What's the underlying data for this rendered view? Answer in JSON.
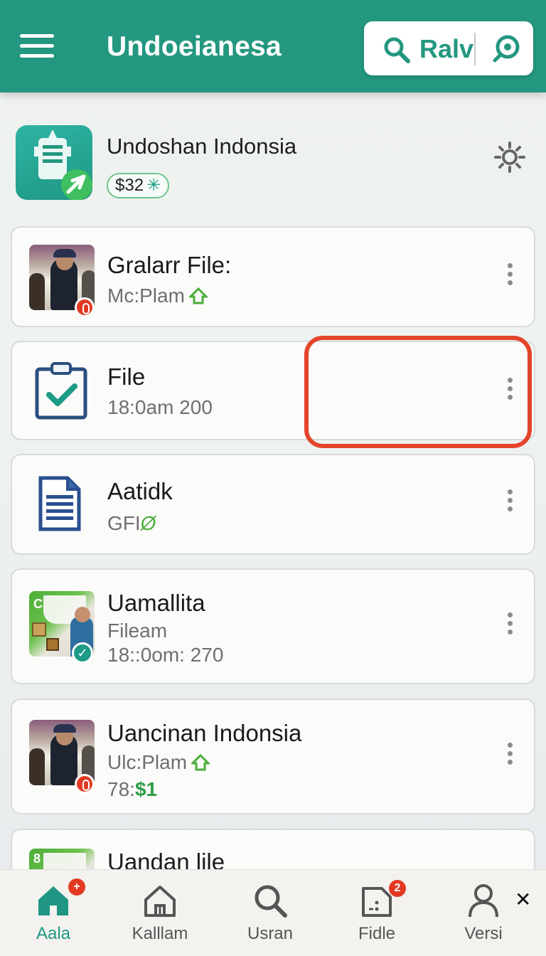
{
  "app_bar": {
    "title": "Undoeianesa",
    "search_text": "Ralv"
  },
  "profile": {
    "name": "Undoshan Indonsia",
    "balance": "$32"
  },
  "items": [
    {
      "title": "Gralarr File:",
      "subtitle": "Mc:Plam"
    },
    {
      "title": "File",
      "subtitle": "18:0am 200"
    },
    {
      "title": "Aatidk",
      "subtitle": "GFI",
      "subtitle_suffix": "Ø"
    },
    {
      "title": "Uamallita",
      "subtitle": "Fileam",
      "subtitle2": "18::0om: 270"
    },
    {
      "title": "Uancinan Indonsia",
      "subtitle": "Ulc:Plam",
      "subtitle2": "78:",
      "subtitle2_suffix": "$1"
    },
    {
      "title": "Uandan lile"
    }
  ],
  "bottom_nav": [
    {
      "label": "Aala",
      "icon": "home-icon",
      "badge": "+",
      "active": true
    },
    {
      "label": "Kalllam",
      "icon": "house-outline-icon"
    },
    {
      "label": "Usran",
      "icon": "search-icon"
    },
    {
      "label": "Fidle",
      "icon": "file-icon",
      "badge": "2"
    },
    {
      "label": "Versi",
      "icon": "user-icon"
    }
  ],
  "colors": {
    "brand": "#23977f",
    "accent_green": "#4cae3a",
    "highlight": "#e4452a",
    "badge_red": "#e23a22"
  }
}
